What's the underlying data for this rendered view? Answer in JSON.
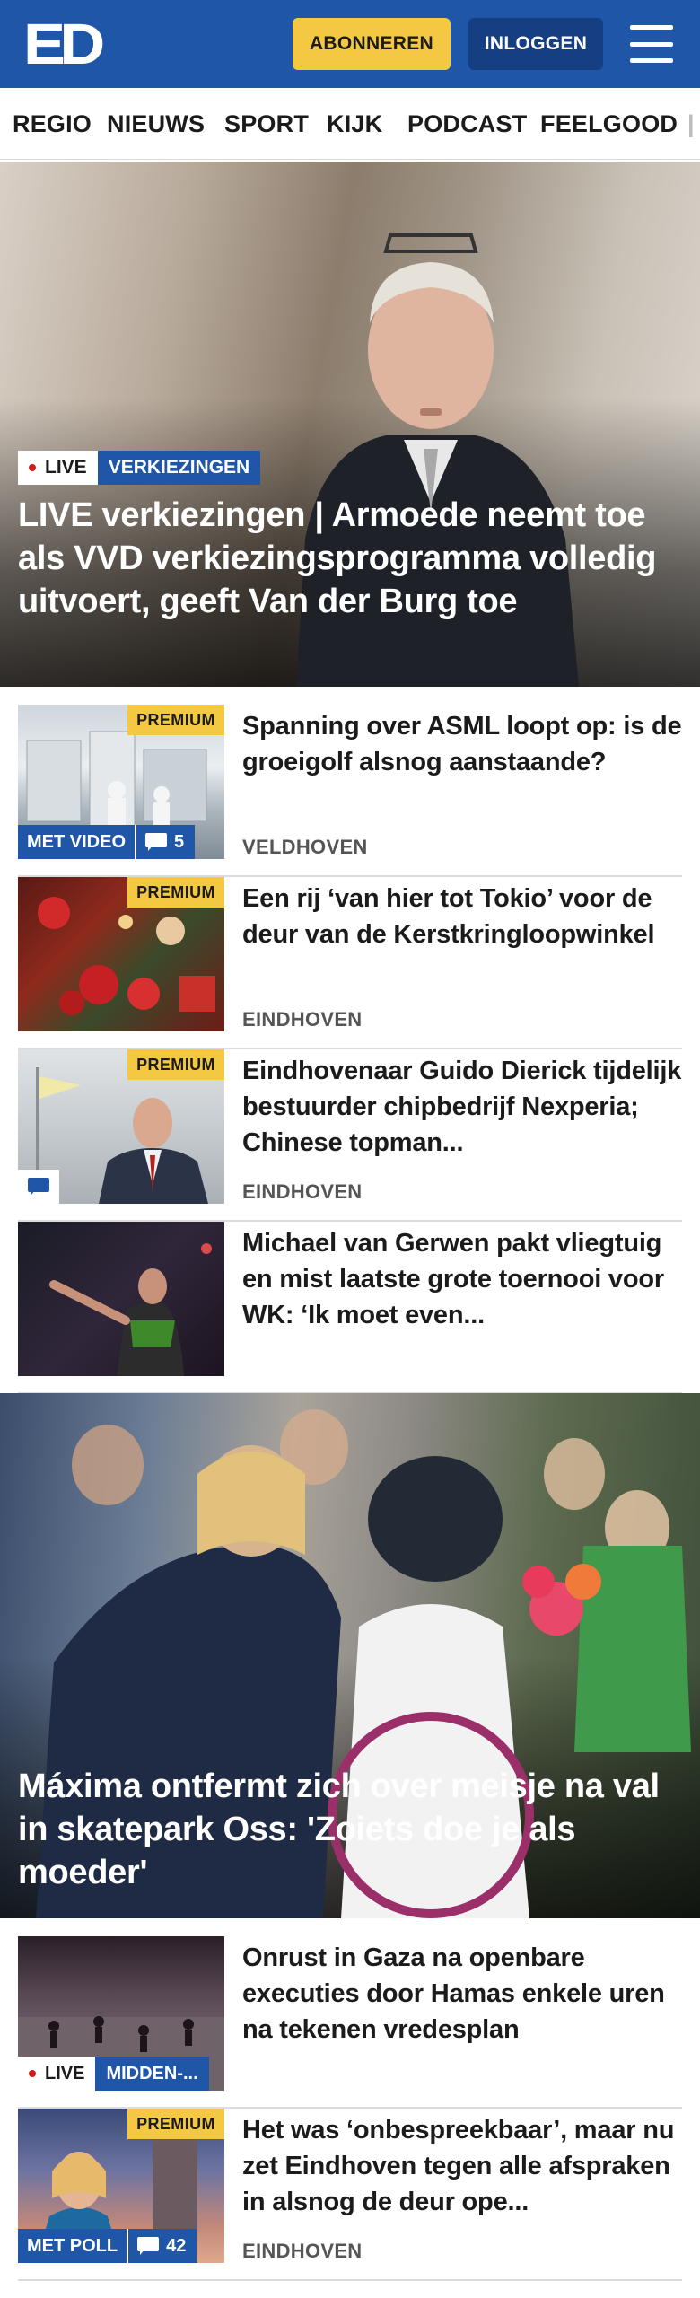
{
  "header": {
    "logo_text": "ED",
    "subscribe_label": "ABONNEREN",
    "login_label": "INLOGGEN",
    "menu_icon": "hamburger-menu-icon",
    "brand_color": "#1f56a8",
    "accent_color": "#f4c842"
  },
  "nav": {
    "items": [
      "REGIO",
      "NIEUWS",
      "SPORT",
      "KIJK",
      "PODCAST",
      "FEELGOOD"
    ]
  },
  "hero1": {
    "live_label": "LIVE",
    "category": "VERKIEZINGEN",
    "title": "LIVE verkiezingen | Armoede neemt toe als VVD verkiezingsprogramma volledig uitvoert, geeft Van der Burg toe"
  },
  "articles": [
    {
      "premium": "PREMIUM",
      "title": "Spanning over ASML loopt op: is de groeigolf alsnog aanstaande?",
      "location": "VELDHOVEN",
      "media_label": "MET VIDEO",
      "comment_count": "5"
    },
    {
      "premium": "PREMIUM",
      "title": "Een rij ‘van hier tot Tokio’ voor de deur van de Kerstkringloopwin­kel",
      "location": "EINDHOVEN"
    },
    {
      "premium": "PREMIUM",
      "title": "Eindhovenaar Guido Dierick tijdelijk bestuurder chipbedrijf Nexperia; Chinese topman...",
      "location": "EINDHOVEN"
    },
    {
      "title": "Michael van Gerwen pakt vliegtuig en mist laatste grote toernooi voor WK: ‘Ik moet even..."
    }
  ],
  "hero2": {
    "title": "Máxima ontfermt zich over meisje na val in skatepark Oss: 'Zoiets doe je als moeder'"
  },
  "articles2": [
    {
      "title": "Onrust in Gaza na openbare executies door Hamas enkele uren na tekenen vredesplan",
      "live_label": "LIVE",
      "category": "MIDDEN-..."
    },
    {
      "premium": "PREMIUM",
      "title": "Het was ‘onbespreekbaar’, maar nu zet Eindhoven tegen alle afspraken in alsnog de deur ope...",
      "location": "EINDHOVEN",
      "media_label": "MET POLL",
      "comment_count": "42"
    }
  ]
}
